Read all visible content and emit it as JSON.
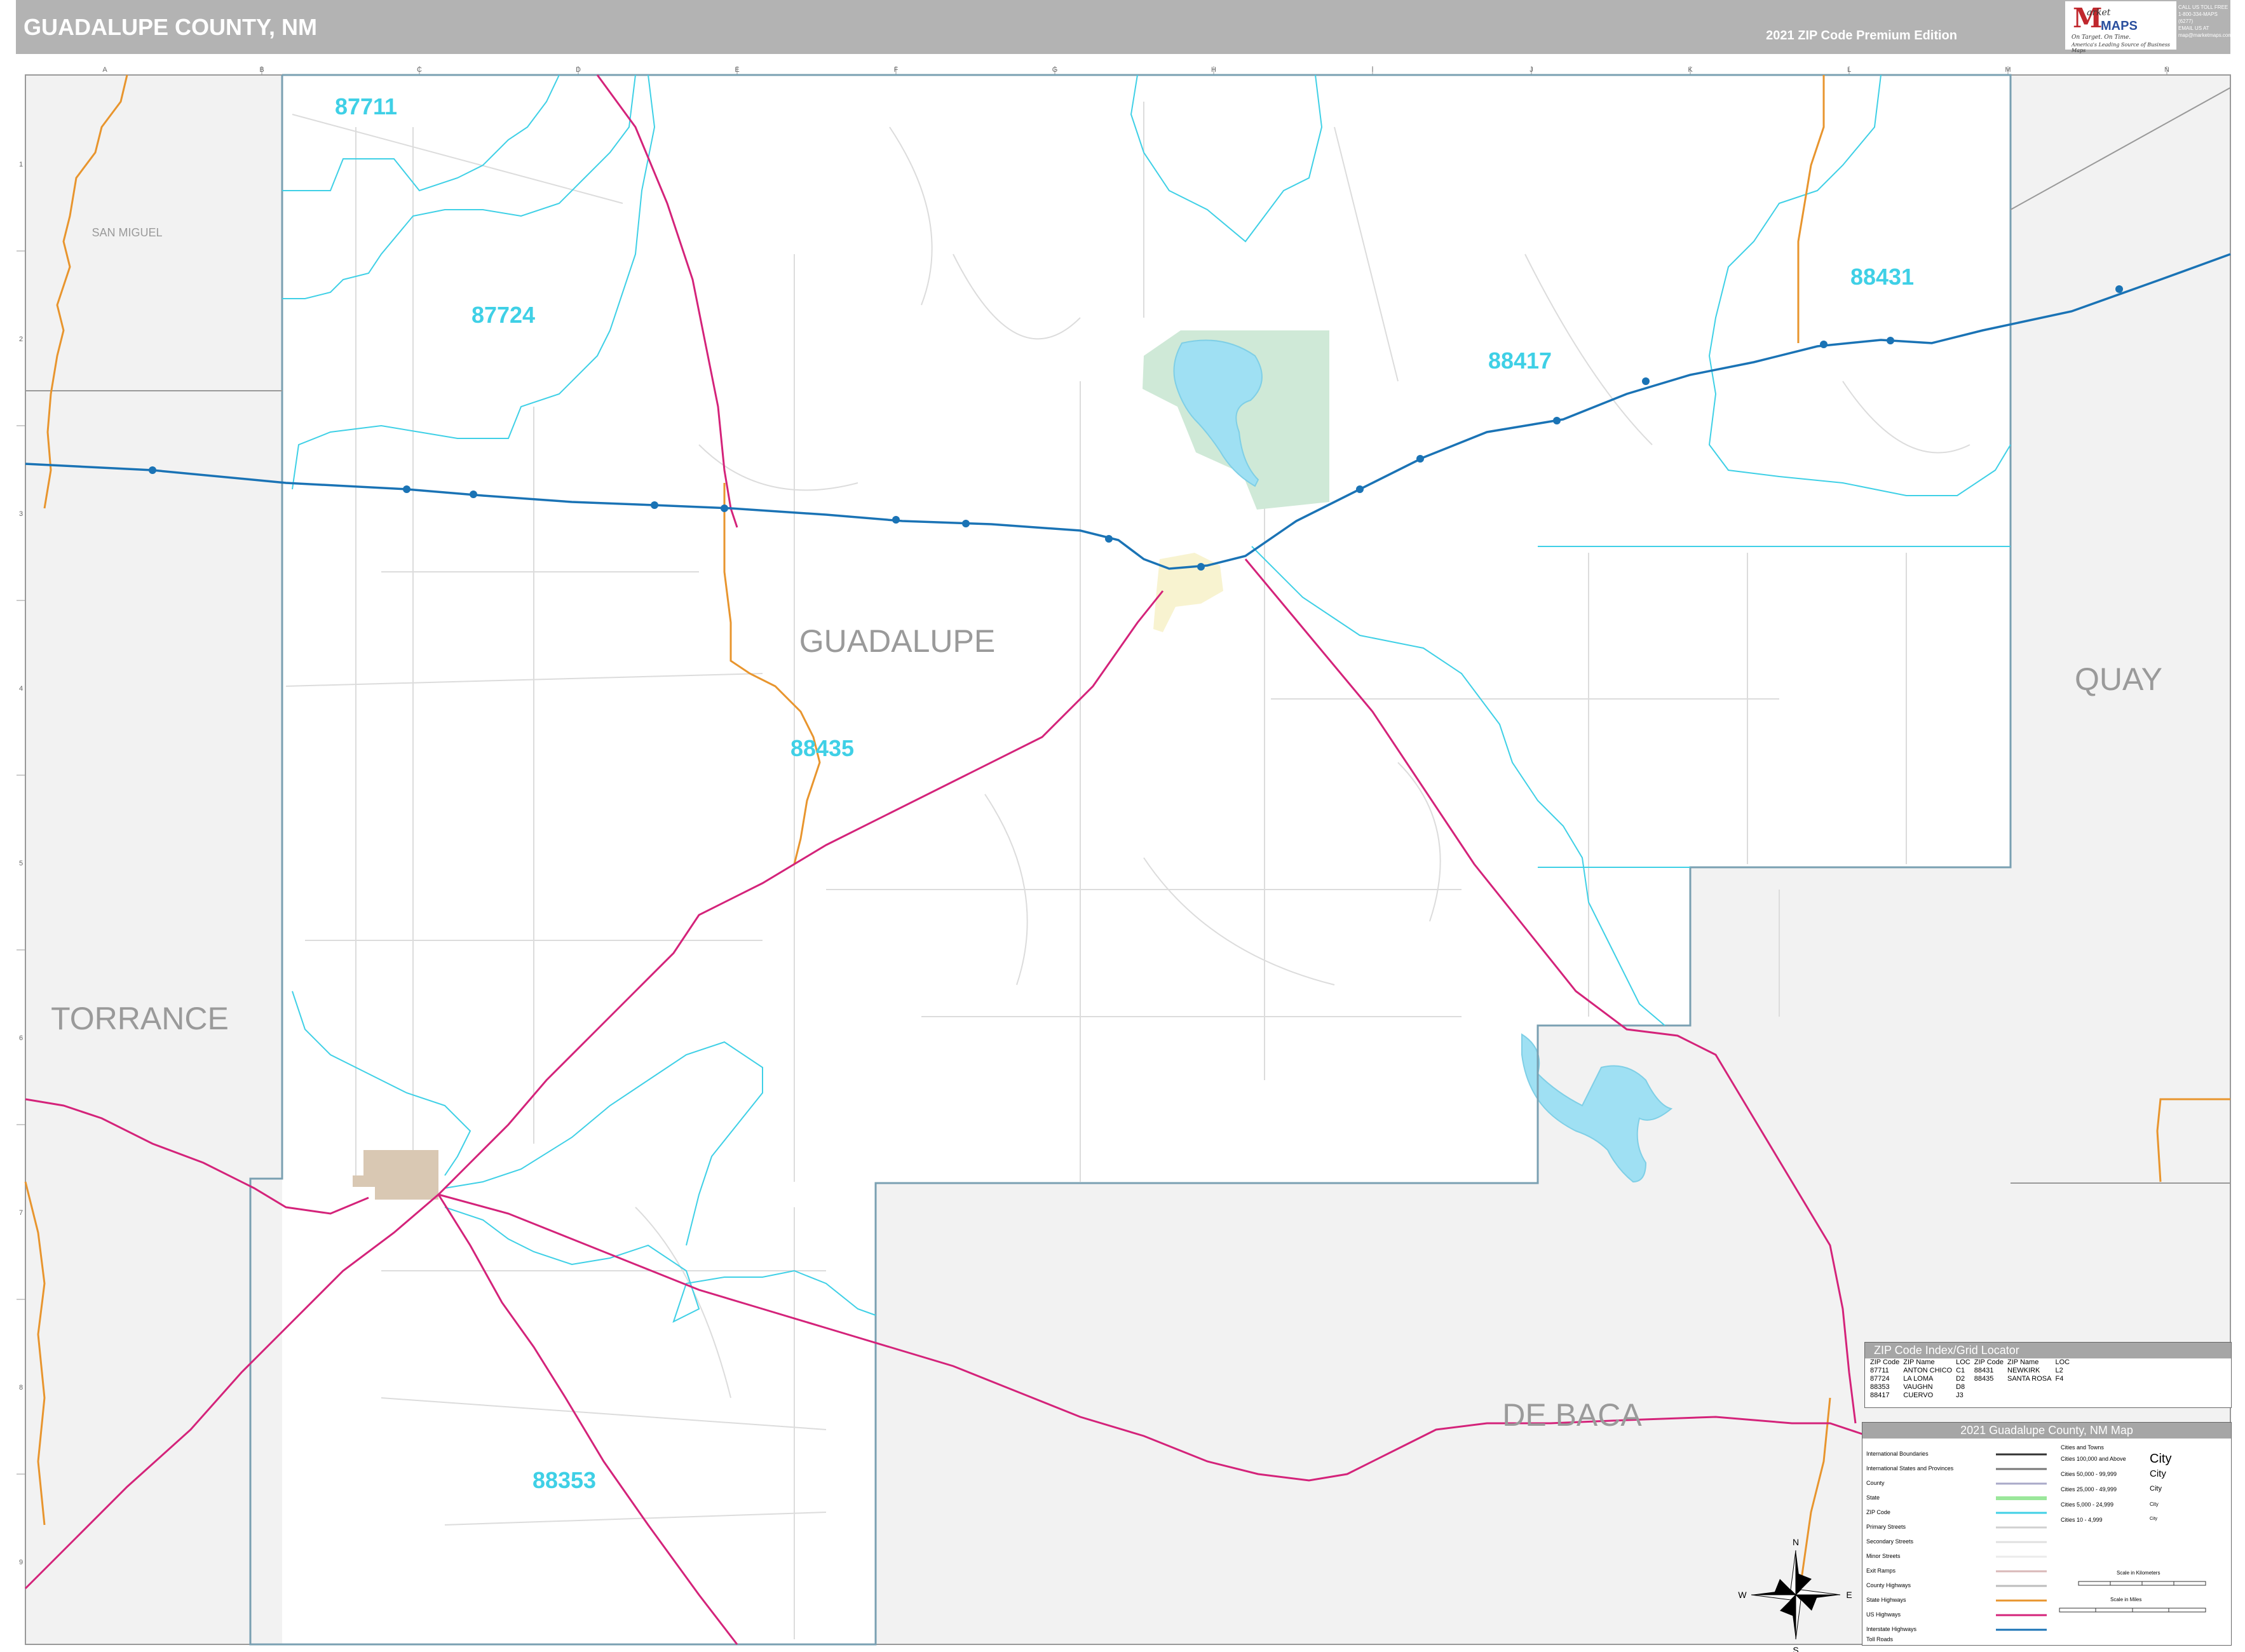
{
  "header": {
    "title": "GUADALUPE COUNTY, NM",
    "edition": "2021 ZIP Code Premium Edition",
    "logo": {
      "brand_top": "arket",
      "brand_bottom": "MAPS",
      "tagline": "On Target. On Time.",
      "subtitle": "America's Leading Source of Business Maps"
    },
    "contact": [
      "CALL US TOLL FREE",
      "1-800-334-MAPS (6277)",
      "EMAIL US AT",
      "map@marketmaps.com"
    ]
  },
  "map": {
    "county_labels": [
      "SAN MIGUEL",
      "TORRANCE",
      "GUADALUPE",
      "QUAY",
      "DE BACA"
    ],
    "zip_labels": [
      "87711",
      "87724",
      "88431",
      "88417",
      "88435",
      "88353"
    ],
    "grid_cols": [
      "A",
      "B",
      "C",
      "D",
      "E",
      "F",
      "G",
      "H",
      "I",
      "J",
      "K",
      "L",
      "M",
      "N"
    ],
    "grid_rows": [
      "1",
      "2",
      "3",
      "4",
      "5",
      "6",
      "7",
      "8",
      "9"
    ],
    "colors": {
      "zip_boundary": "#3fd0e6",
      "county_boundary": "#7aa0b2",
      "interstate": "#1a73b5",
      "us_highway": "#d4237a",
      "state_highway": "#e8952e",
      "water": "#9fe0f3",
      "park": "#cfe9d7",
      "outside": "#f2f2f2"
    },
    "compass": {
      "n": "N",
      "s": "S",
      "e": "E",
      "w": "W"
    }
  },
  "zip_index": {
    "title": "ZIP Code Index/Grid Locator",
    "headers": [
      "ZIP Code",
      "ZIP Name",
      "LOC",
      "ZIP Code",
      "ZIP Name",
      "LOC"
    ],
    "rows": [
      [
        "87711",
        "ANTON CHICO",
        "C1",
        "88431",
        "NEWKIRK",
        "L2"
      ],
      [
        "87724",
        "LA LOMA",
        "D2",
        "88435",
        "SANTA ROSA",
        "F4"
      ],
      [
        "88353",
        "VAUGHN",
        "D8",
        "",
        "",
        ""
      ],
      [
        "88417",
        "CUERVO",
        "J3",
        "",
        "",
        ""
      ]
    ]
  },
  "legend": {
    "title": "2021 Guadalupe County, NM Map",
    "left_items": [
      "International Boundaries",
      "International States and Provinces",
      "County",
      "State",
      "ZIP Code",
      "Primary Streets",
      "Secondary Streets",
      "Minor Streets",
      "Exit Ramps",
      "County Highways",
      "State Highways",
      "US Highways",
      "Interstate Highways",
      "Toll Roads"
    ],
    "cities_header": "Cities and Towns",
    "city_items": [
      {
        "range": "Cities 100,000 and Above",
        "sample": "City"
      },
      {
        "range": "Cities 50,000 - 99,999",
        "sample": "City"
      },
      {
        "range": "Cities 25,000 - 49,999",
        "sample": "City"
      },
      {
        "range": "Cities 5,000 - 24,999",
        "sample": "City"
      },
      {
        "range": "Cities 10 - 4,999",
        "sample": "City"
      }
    ],
    "scale_km": "Scale in Kilometers",
    "scale_mi": "Scale in Miles"
  }
}
